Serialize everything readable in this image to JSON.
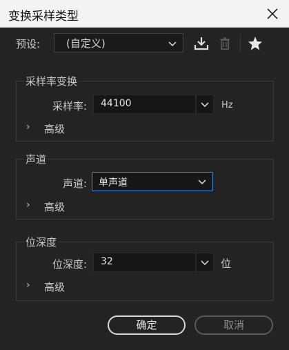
{
  "window": {
    "title": "变换采样类型"
  },
  "preset": {
    "label": "预设:",
    "value": "(自定义)",
    "icons": [
      "download-preset-icon",
      "delete-preset-icon",
      "favorite-star-icon"
    ]
  },
  "sample_rate_group": {
    "title": "采样率变换",
    "field_label": "采样率:",
    "value": "44100",
    "unit": "Hz",
    "advanced_label": "高级"
  },
  "channel_group": {
    "title": "声道",
    "field_label": "声道:",
    "value": "单声道",
    "advanced_label": "高级"
  },
  "bit_depth_group": {
    "title": "位深度",
    "field_label": "位深度:",
    "value": "32",
    "unit": "位",
    "advanced_label": "高级"
  },
  "buttons": {
    "ok": "确定",
    "cancel": "取消"
  },
  "colors": {
    "focus_border": "#3a8ee6",
    "panel_bg": "#232323"
  }
}
